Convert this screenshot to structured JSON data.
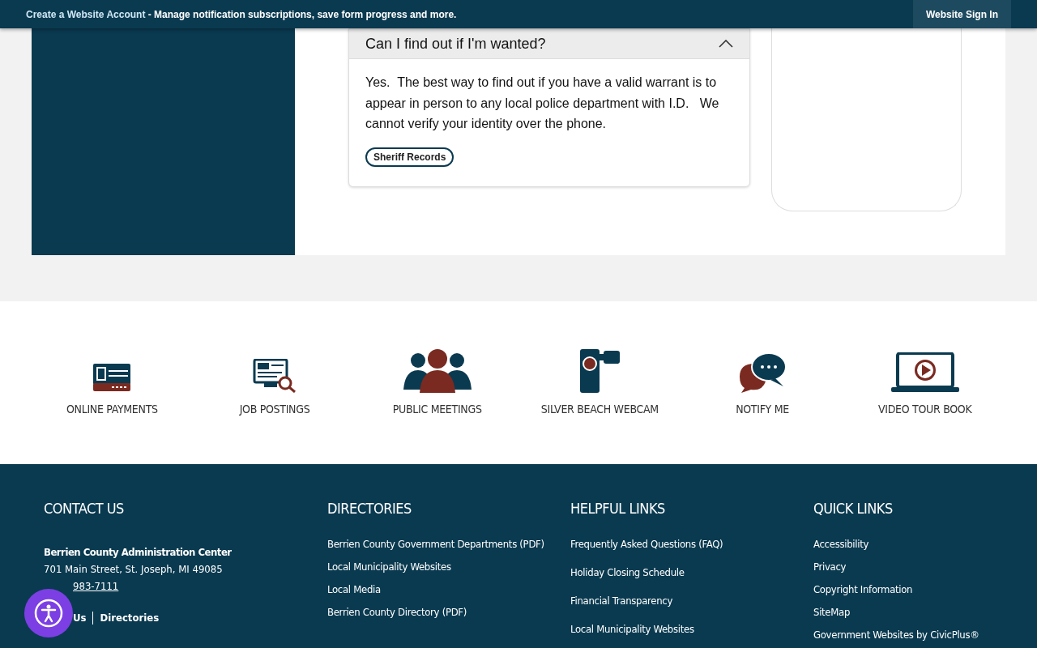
{
  "top_bar": {
    "link": "Create a Website Account",
    "text": " - Manage notification subscriptions, save form progress and more.",
    "button": "Website Sign In"
  },
  "faq": {
    "question": "Can I find out if I'm wanted?",
    "expanded": true,
    "answer": "Yes.  The best way to find out if you have a valid warrant is to appear in person to any local police department with I.D.   We cannot verify your identity over the phone.",
    "tag": "Sheriff Records"
  },
  "quick_icons": [
    {
      "kind": "payments",
      "label": "ONLINE PAYMENTS"
    },
    {
      "kind": "jobs",
      "label": "JOB POSTINGS"
    },
    {
      "kind": "meetings",
      "label": "PUBLIC MEETINGS"
    },
    {
      "kind": "webcam",
      "label": "SILVER BEACH WEBCAM"
    },
    {
      "kind": "notify",
      "label": "NOTIFY ME"
    },
    {
      "kind": "video",
      "label": "VIDEO TOUR BOOK"
    }
  ],
  "footer": {
    "contact": {
      "title": "CONTACT US",
      "name": "Berrien County Administration Center",
      "address": "701 Main Street, St. Joseph, MI 49085",
      "phone": "983-7111",
      "links": [
        "Us",
        "Directories"
      ]
    },
    "columns": [
      {
        "title": "DIRECTORIES",
        "links": [
          "Berrien County Government Departments (PDF)",
          "Local Municipality Websites",
          "Local Media",
          "Berrien County Directory (PDF)"
        ]
      },
      {
        "title": "HELPFUL LINKS",
        "links": [
          "Frequently Asked Questions (FAQ)",
          "Holiday Closing Schedule",
          "Financial Transparency",
          "Local Municipality Websites"
        ]
      },
      {
        "title": "QUICK LINKS",
        "links": [
          "Accessibility",
          "Privacy",
          "Copyright Information",
          "SiteMap",
          "Government Websites by CivicPlus®"
        ]
      }
    ]
  }
}
